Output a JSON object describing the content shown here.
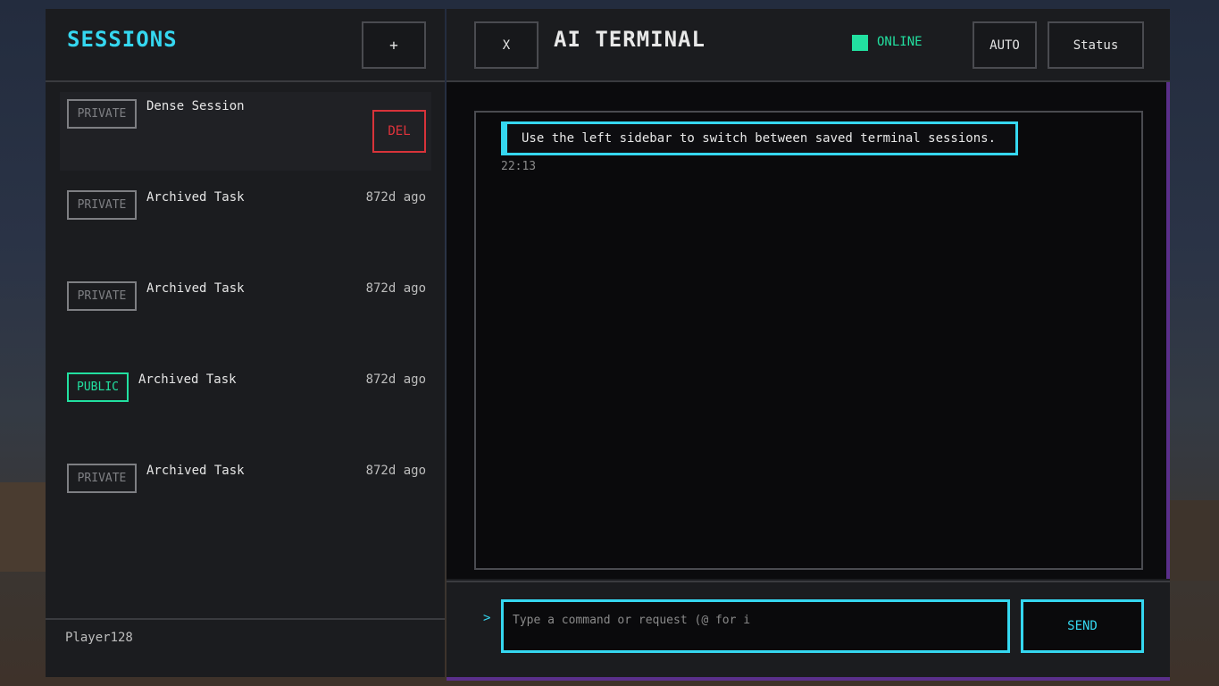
{
  "sidebar": {
    "title": "SESSIONS",
    "new_label": "+",
    "sessions": [
      {
        "visibility": "PRIVATE",
        "name": "Dense Session",
        "time": "",
        "delete_label": "DEL"
      },
      {
        "visibility": "PRIVATE",
        "name": "Archived Task",
        "time": "872d ago"
      },
      {
        "visibility": "PRIVATE",
        "name": "Archived Task",
        "time": "872d ago"
      },
      {
        "visibility": "PUBLIC",
        "name": "Archived Task",
        "time": "872d ago"
      },
      {
        "visibility": "PRIVATE",
        "name": "Archived Task",
        "time": "872d ago"
      }
    ],
    "player": "Player128"
  },
  "header": {
    "close_label": "X",
    "title": "AI TERMINAL",
    "status_text": "ONLINE",
    "status_color": "#22e0a0",
    "auto_label": "AUTO",
    "status_button_label": "Status"
  },
  "chat": {
    "messages": [
      {
        "text": "Use the left sidebar to switch between saved terminal sessions.",
        "time": "22:13"
      }
    ]
  },
  "input": {
    "prompt_symbol": ">",
    "placeholder": "Type a command or request (@ for i",
    "value": "",
    "send_label": "SEND"
  },
  "colors": {
    "accent": "#35d7f0",
    "public": "#22e0a0",
    "danger": "#d8333a",
    "frame": "#5a2f8a"
  }
}
